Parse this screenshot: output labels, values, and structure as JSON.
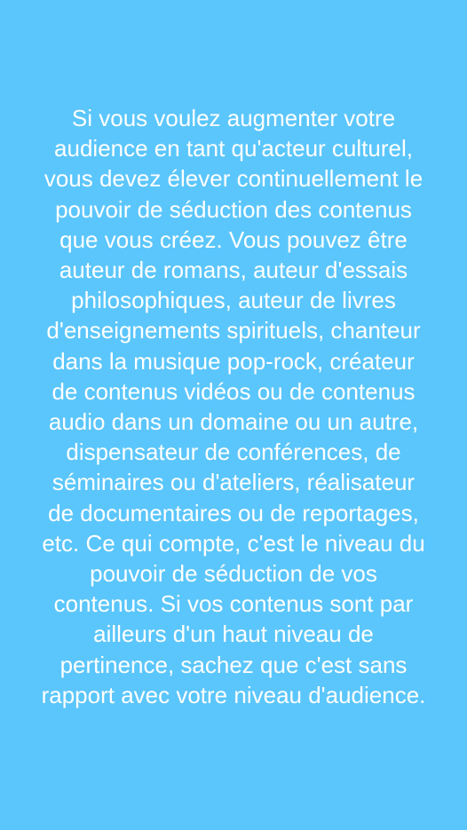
{
  "background_color": "#5BC6FB",
  "text_color": "#FFFFFF",
  "text_lines": [
    "Si vous voulez augmenter votre",
    "audience en tant qu'acteur culturel,",
    "vous devez élever continuellement le",
    "pouvoir de séduction des contenus",
    "que vous créez. Vous pouvez être",
    "auteur de romans, auteur d'essais",
    "philosophiques, auteur de livres",
    "d'enseignements spirituels, chanteur",
    "dans la musique pop-rock, créateur",
    "de contenus vidéos ou de contenus",
    "audio dans un domaine ou un autre,",
    "dispensateur de conférences, de",
    "séminaires ou d'ateliers, réalisateur",
    "de documentaires ou de reportages,",
    "etc. Ce qui compte, c'est le niveau du",
    "pouvoir de séduction de vos",
    "contenus. Si vos contenus sont par",
    "ailleurs d'un haut niveau de",
    "pertinence, sachez que c'est sans",
    "rapport avec votre niveau d'audience."
  ]
}
